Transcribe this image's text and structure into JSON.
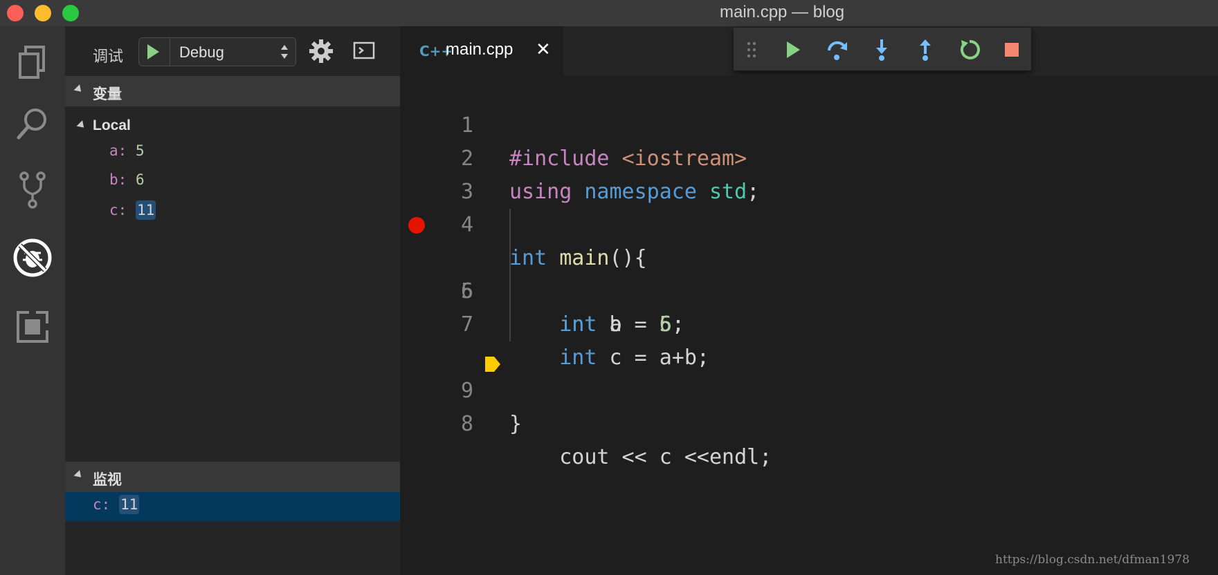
{
  "window": {
    "title": "main.cpp — blog"
  },
  "sidebar": {
    "debug_label": "调试",
    "config_name": "Debug",
    "variables_header": "变量",
    "scope_label": "Local",
    "variables": [
      {
        "name": "a:",
        "value": "5"
      },
      {
        "name": "b:",
        "value": "6"
      },
      {
        "name": "c:",
        "value": "11"
      }
    ],
    "watch_header": "监视",
    "watch": {
      "name": "c:",
      "value": "11"
    }
  },
  "editor": {
    "tab_label": "main.cpp",
    "tab_icon": "C++",
    "tab_close": "✕",
    "line_numbers": [
      "1",
      "2",
      "3",
      "4",
      "5",
      "6",
      "7",
      "8",
      "9"
    ],
    "breakpoint_line": 5,
    "current_line": 8,
    "lines": [
      [
        {
          "t": "#include ",
          "c": "k-pink"
        },
        {
          "t": "<iostream>",
          "c": "k-str"
        }
      ],
      [
        {
          "t": "using ",
          "c": "k-pink"
        },
        {
          "t": "namespace ",
          "c": "k-blue"
        },
        {
          "t": "std",
          "c": "k-teal"
        },
        {
          "t": ";",
          "c": "k-txt"
        }
      ],
      [],
      [
        {
          "t": "int ",
          "c": "k-blue"
        },
        {
          "t": "main",
          "c": "k-fn"
        },
        {
          "t": "(){",
          "c": "k-txt"
        }
      ],
      [
        {
          "t": "    ",
          "c": "k-txt"
        },
        {
          "t": "int ",
          "c": "k-blue"
        },
        {
          "t": "a = ",
          "c": "k-txt"
        },
        {
          "t": "5",
          "c": "k-num"
        },
        {
          "t": ";",
          "c": "k-txt"
        }
      ],
      [
        {
          "t": "    ",
          "c": "k-txt"
        },
        {
          "t": "int ",
          "c": "k-blue"
        },
        {
          "t": "b = ",
          "c": "k-txt"
        },
        {
          "t": "6",
          "c": "k-num"
        },
        {
          "t": ";",
          "c": "k-txt"
        }
      ],
      [
        {
          "t": "    ",
          "c": "k-txt"
        },
        {
          "t": "int ",
          "c": "k-blue"
        },
        {
          "t": "c = a+b;",
          "c": "k-txt"
        }
      ],
      [
        {
          "t": "    cout << c <<endl;",
          "c": "k-txt"
        }
      ],
      [
        {
          "t": "}",
          "c": "k-txt"
        }
      ]
    ]
  },
  "debug_toolbar": {
    "icons": [
      "drag-handle-icon",
      "continue-icon",
      "step-over-icon",
      "step-into-icon",
      "step-out-icon",
      "restart-icon",
      "stop-icon"
    ]
  },
  "activity_bar": {
    "icons": [
      "explorer-icon",
      "search-icon",
      "source-control-icon",
      "debug-icon",
      "extensions-icon"
    ]
  },
  "colors": {
    "accent_green": "#89d185",
    "breakpoint": "#e51400",
    "current_line_bg": "#4b4a1e",
    "stop": "#f48771"
  },
  "watermark": "https://blog.csdn.net/dfman1978"
}
